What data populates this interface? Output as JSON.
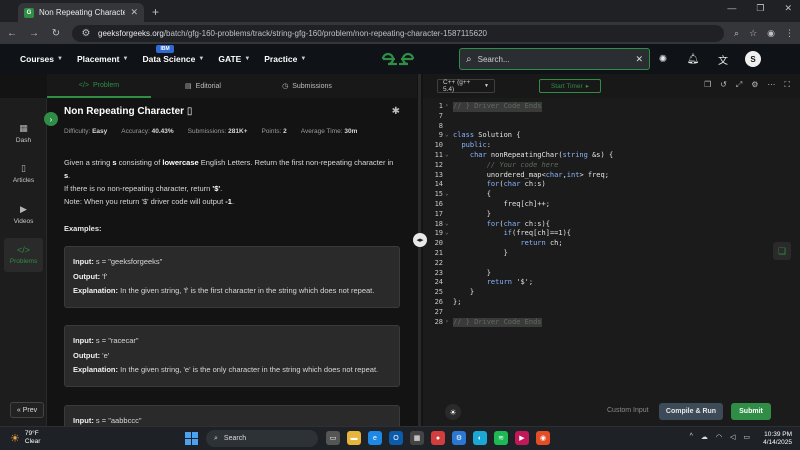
{
  "browser": {
    "tab_title": "Non Repeating Character | Pra",
    "url_domain": "geeksforgeeks.org",
    "url_path": "/batch/gfg-160-problems/track/string-gfg-160/problem/non-repeating-character-1587115620"
  },
  "header": {
    "menu": [
      {
        "label": "Courses"
      },
      {
        "label": "Placement"
      },
      {
        "label": "Data Science"
      },
      {
        "label": "GATE"
      },
      {
        "label": "Practice"
      }
    ],
    "ibm_badge": "IBM",
    "search_placeholder": "Search...",
    "avatar_letter": "S"
  },
  "problem_tabs": {
    "problem": "Problem",
    "editorial": "Editorial",
    "submissions": "Submissions"
  },
  "leftnav": {
    "dash": "Dash",
    "articles": "Articles",
    "videos": "Videos",
    "problems": "Problems",
    "prev": "Prev"
  },
  "problem": {
    "title": "Non Repeating Character",
    "difficulty_label": "Difficulty:",
    "difficulty": "Easy",
    "accuracy_label": "Accuracy:",
    "accuracy": "40.43%",
    "submissions_label": "Submissions:",
    "submissions": "281K+",
    "points_label": "Points:",
    "points": "2",
    "avg_time_label": "Average Time:",
    "avg_time": "30m",
    "desc1_a": "Given a string ",
    "desc1_b": "s",
    "desc1_c": " consisting of ",
    "desc1_d": "lowercase",
    "desc1_e": " English Letters. Return the first non-repeating character in ",
    "desc1_f": "s",
    "desc1_g": ".",
    "desc2_a": "If there is no non-repeating character, return ",
    "desc2_b": "'$'",
    "desc2_c": ".",
    "desc3_a": "Note: When you return '$' driver code will output ",
    "desc3_b": "-1",
    "desc3_c": ".",
    "examples_heading": "Examples:",
    "examples": [
      {
        "input_label": "Input:",
        "input": "s = \"geeksforgeeks\"",
        "output_label": "Output:",
        "output": "'f'",
        "expl_label": "Explanation:",
        "expl": "In the given string, 'f' is the first character in the string which does not repeat."
      },
      {
        "input_label": "Input:",
        "input": "s = \"racecar\"",
        "output_label": "Output:",
        "output": "'e'",
        "expl_label": "Explanation:",
        "expl": "In the given string, 'e' is the only character in the string which does not repeat."
      },
      {
        "input_label": "Input:",
        "input": "s = \"aabbccc\""
      }
    ]
  },
  "editor": {
    "language": "C++ (g++ 5.4)",
    "start_timer": "Start Timer",
    "custom_input": "Custom Input",
    "compile_run": "Compile & Run",
    "submit": "Submit",
    "lines": [
      {
        "n": "1",
        "text": "// } Driver Code Ends",
        "type": "collapsed",
        "fold": "›"
      },
      {
        "n": "7",
        "text": "",
        "type": "plain",
        "fold": ""
      },
      {
        "n": "8",
        "text": "",
        "type": "plain",
        "fold": ""
      },
      {
        "n": "9",
        "text": "class Solution {",
        "type": "plain",
        "fold": "⌄"
      },
      {
        "n": "10",
        "text": "  public:",
        "type": "plain",
        "fold": ""
      },
      {
        "n": "11",
        "text": "    char nonRepeatingChar(string &s) {",
        "type": "plain",
        "fold": "⌄"
      },
      {
        "n": "12",
        "text": "        // Your code here",
        "type": "comment",
        "fold": ""
      },
      {
        "n": "13",
        "text": "        unordered_map<char,int> freq;",
        "type": "plain",
        "fold": ""
      },
      {
        "n": "14",
        "text": "        for(char ch:s)",
        "type": "plain",
        "fold": ""
      },
      {
        "n": "15",
        "text": "        {",
        "type": "plain",
        "fold": "⌄"
      },
      {
        "n": "16",
        "text": "            freq[ch]++;",
        "type": "plain",
        "fold": ""
      },
      {
        "n": "17",
        "text": "        }",
        "type": "plain",
        "fold": ""
      },
      {
        "n": "18",
        "text": "        for(char ch:s){",
        "type": "plain",
        "fold": "⌄"
      },
      {
        "n": "19",
        "text": "            if(freq[ch]==1){",
        "type": "plain",
        "fold": "⌄"
      },
      {
        "n": "20",
        "text": "                return ch;",
        "type": "plain",
        "fold": ""
      },
      {
        "n": "21",
        "text": "            }",
        "type": "plain",
        "fold": ""
      },
      {
        "n": "22",
        "text": "",
        "type": "plain",
        "fold": ""
      },
      {
        "n": "23",
        "text": "        }",
        "type": "plain",
        "fold": ""
      },
      {
        "n": "24",
        "text": "        return '$';",
        "type": "plain",
        "fold": ""
      },
      {
        "n": "25",
        "text": "    }",
        "type": "plain",
        "fold": ""
      },
      {
        "n": "26",
        "text": "};",
        "type": "plain",
        "fold": ""
      },
      {
        "n": "27",
        "text": "",
        "type": "plain",
        "fold": ""
      },
      {
        "n": "28",
        "text": "// } Driver Code Ends",
        "type": "collapsed",
        "fold": "›"
      }
    ]
  },
  "taskbar": {
    "temp": "79°F",
    "condition": "Clear",
    "search": "Search",
    "time": "10:39 PM",
    "date": "4/14/2025"
  },
  "colors": {
    "gfg_green": "#2f8d46",
    "compile_button": "#3d4a58",
    "panel_bg": "#131313"
  }
}
